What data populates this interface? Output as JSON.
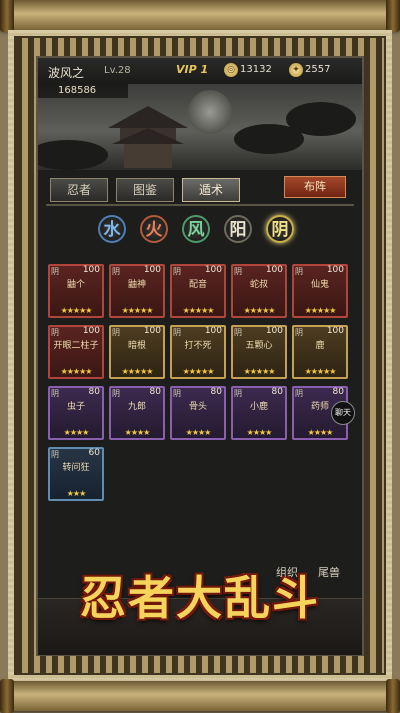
{
  "header": {
    "player_name": "波风之",
    "level": "Lv.28",
    "vip": "VIP 1",
    "coins": "13132",
    "tokens": "2557",
    "power": "168586"
  },
  "tabs": [
    "忍者",
    "图鉴",
    "遁术"
  ],
  "formation_button": "布阵",
  "elements": [
    "水",
    "火",
    "风",
    "阳",
    "阴"
  ],
  "cards": [
    {
      "badge": "阴",
      "level": "100",
      "name": "鼬个",
      "stars": "★★★★★",
      "color": "red"
    },
    {
      "badge": "阴",
      "level": "100",
      "name": "鼬神",
      "stars": "★★★★★",
      "color": "red"
    },
    {
      "badge": "阴",
      "level": "100",
      "name": "配音",
      "stars": "★★★★★",
      "color": "red"
    },
    {
      "badge": "阴",
      "level": "100",
      "name": "蛇叔",
      "stars": "★★★★★",
      "color": "red"
    },
    {
      "badge": "阴",
      "level": "100",
      "name": "仙鬼",
      "stars": "★★★★★",
      "color": "red"
    },
    {
      "badge": "阴",
      "level": "100",
      "name": "开眼二柱子",
      "stars": "★★★★★",
      "color": "red"
    },
    {
      "badge": "阴",
      "level": "100",
      "name": "暗根",
      "stars": "★★★★★",
      "color": "gold"
    },
    {
      "badge": "阴",
      "level": "100",
      "name": "打不死",
      "stars": "★★★★★",
      "color": "gold"
    },
    {
      "badge": "阴",
      "level": "100",
      "name": "五颗心",
      "stars": "★★★★★",
      "color": "gold"
    },
    {
      "badge": "阴",
      "level": "100",
      "name": "鹿",
      "stars": "★★★★★",
      "color": "gold"
    },
    {
      "badge": "阴",
      "level": "80",
      "name": "虫子",
      "stars": "★★★★",
      "color": "purple"
    },
    {
      "badge": "阴",
      "level": "80",
      "name": "九郎",
      "stars": "★★★★",
      "color": "purple"
    },
    {
      "badge": "阴",
      "level": "80",
      "name": "骨头",
      "stars": "★★★★",
      "color": "purple"
    },
    {
      "badge": "阴",
      "level": "80",
      "name": "小鹿",
      "stars": "★★★★",
      "color": "purple"
    },
    {
      "badge": "阴",
      "level": "80",
      "name": "药师",
      "stars": "★★★★",
      "color": "purple"
    },
    {
      "badge": "阴",
      "level": "60",
      "name": "转问狂",
      "stars": "★★★",
      "color": "blue"
    }
  ],
  "chat_button": "聊天",
  "bottom_menu": [
    "组织",
    "尾兽"
  ],
  "banner": "忍者大乱斗"
}
